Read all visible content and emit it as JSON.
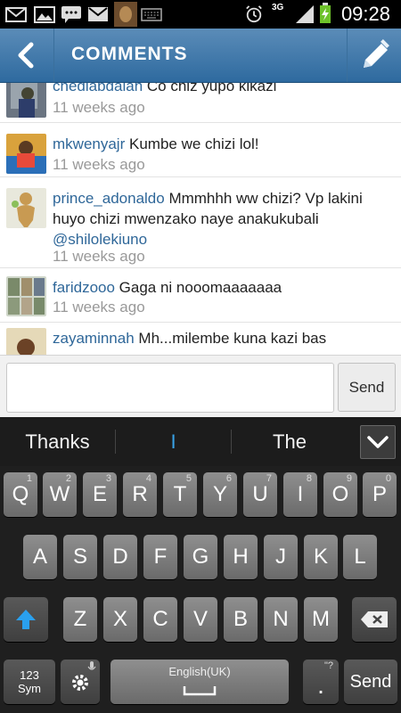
{
  "status_bar": {
    "time": "09:28",
    "network": "3G",
    "icons": [
      "mail-icon",
      "gallery-icon",
      "chat-icon",
      "gmail-icon",
      "bird-notification-icon",
      "keyboard-icon",
      "alarm-icon",
      "signal-icon",
      "battery-charging-icon"
    ]
  },
  "header": {
    "title": "COMMENTS",
    "back_icon": "back-chevron-icon",
    "edit_icon": "pencil-icon",
    "color": "#3a75a8"
  },
  "comments": [
    {
      "user": "chediabdalah",
      "text": "Co chiz yupo kikazi",
      "time": "11 weeks ago"
    },
    {
      "user": "mkwenyajr",
      "text": "Kumbe we chizi lol!",
      "time": "11 weeks ago"
    },
    {
      "user": "prince_adonaldo",
      "text": "Mmmhhh ww chizi? Vp lakini huyo chizi mwenzako naye anakukubali",
      "mention": "@shilolekiuno",
      "time": "11 weeks ago"
    },
    {
      "user": "faridzooo",
      "text": "Gaga ni nooomaaaaaaa",
      "time": "11 weeks ago"
    },
    {
      "user": "zayaminnah",
      "text": "Mh...milembe kuna kazi bas",
      "time": ""
    }
  ],
  "compose": {
    "input_value": "",
    "send_label": "Send"
  },
  "suggestions": {
    "left": "Thanks",
    "middle": "I",
    "right": "The",
    "collapse_icon": "chevron-down-icon"
  },
  "keyboard": {
    "row1": [
      {
        "k": "Q",
        "h": "1"
      },
      {
        "k": "W",
        "h": "2"
      },
      {
        "k": "E",
        "h": "3"
      },
      {
        "k": "R",
        "h": "4"
      },
      {
        "k": "T",
        "h": "5"
      },
      {
        "k": "Y",
        "h": "6"
      },
      {
        "k": "U",
        "h": "7"
      },
      {
        "k": "I",
        "h": "8"
      },
      {
        "k": "O",
        "h": "9"
      },
      {
        "k": "P",
        "h": "0"
      }
    ],
    "row2": [
      "A",
      "S",
      "D",
      "F",
      "G",
      "H",
      "J",
      "K",
      "L"
    ],
    "row3": [
      "Z",
      "X",
      "C",
      "V",
      "B",
      "N",
      "M"
    ],
    "sym_label": "123\nSym",
    "space_label": "English(UK)",
    "period_label": ".",
    "period_hint": "\"?",
    "send_label": "Send",
    "shift_icon": "shift-arrow-icon",
    "backspace_icon": "backspace-icon",
    "settings_icon": "gear-icon",
    "mic_icon": "microphone-icon"
  }
}
